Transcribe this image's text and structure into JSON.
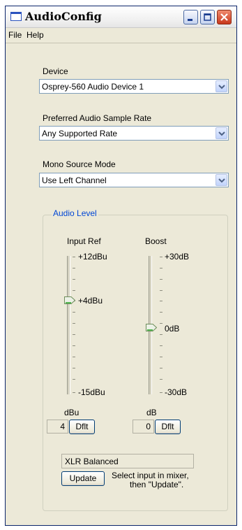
{
  "window": {
    "title": "AudioConfig"
  },
  "menu": {
    "file": "File",
    "help": "Help"
  },
  "device": {
    "label": "Device",
    "value": "Osprey-560 Audio Device 1"
  },
  "sample_rate": {
    "label": "Preferred Audio Sample Rate",
    "value": "Any Supported Rate"
  },
  "mono_mode": {
    "label": "Mono Source Mode",
    "value": "Use Left Channel"
  },
  "audio_level": {
    "title": "Audio Level",
    "input_ref": {
      "label": "Input Ref",
      "ticks": {
        "top": "+12dBu",
        "mid": "+4dBu",
        "bottom": "-15dBu"
      },
      "unit": "dBu",
      "value": "4",
      "default_button": "Dflt"
    },
    "boost": {
      "label": "Boost",
      "ticks": {
        "top": "+30dB",
        "mid": "0dB",
        "bottom": "-30dB"
      },
      "unit": "dB",
      "value": "0",
      "default_button": "Dflt"
    },
    "connector": "XLR Balanced",
    "update_button": "Update",
    "hint_line1": "Select input in mixer,",
    "hint_line2": "then \"Update\"."
  }
}
